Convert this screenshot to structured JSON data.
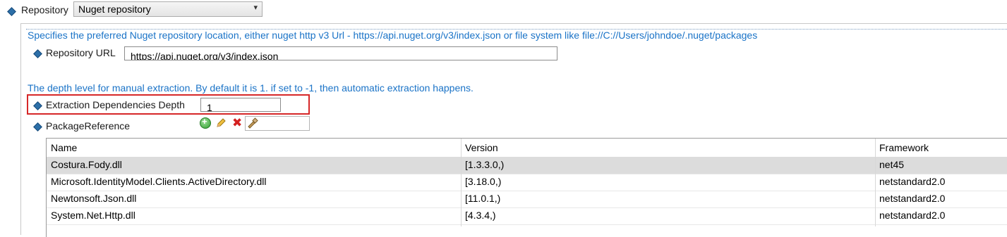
{
  "repository": {
    "label": "Repository",
    "selected": "Nuget repository",
    "arrow": "▾"
  },
  "repo_description": "Specifies the preferred Nuget repository location, either nuget http v3 Url - https://api.nuget.org/v3/index.json or file system like file://C://Users/johndoe/.nuget/packages",
  "repository_url": {
    "label": "Repository URL",
    "value": "https://api.nuget.org/v3/index.json"
  },
  "depth_description": "The depth level for manual extraction. By default it is 1. if set to -1, then automatic extraction happens.",
  "extraction_depth": {
    "label": "Extraction Dependencies Depth",
    "value": "1"
  },
  "package_reference": {
    "label": "PackageReference",
    "delete_glyph": "✖"
  },
  "table": {
    "headers": [
      "Name",
      "Version",
      "Framework"
    ],
    "rows": [
      {
        "name": "Costura.Fody.dll",
        "version": "[1.3.3.0,)",
        "framework": "net45"
      },
      {
        "name": "Microsoft.IdentityModel.Clients.ActiveDirectory.dll",
        "version": "[3.18.0,)",
        "framework": "netstandard2.0"
      },
      {
        "name": "Newtonsoft.Json.dll",
        "version": "[11.0.1,)",
        "framework": "netstandard2.0"
      },
      {
        "name": "System.Net.Http.dll",
        "version": "[4.3.4,)",
        "framework": "netstandard2.0"
      }
    ]
  },
  "colors": {
    "description_text": "#1a73c7",
    "bullet": "#2c6fa8",
    "highlight_border": "#d62728",
    "selected_row": "#dcdcdc"
  },
  "icons": [
    "diamond-bullet-icon",
    "add-icon",
    "edit-icon",
    "delete-icon",
    "filter-icon",
    "chevron-down-icon"
  ]
}
